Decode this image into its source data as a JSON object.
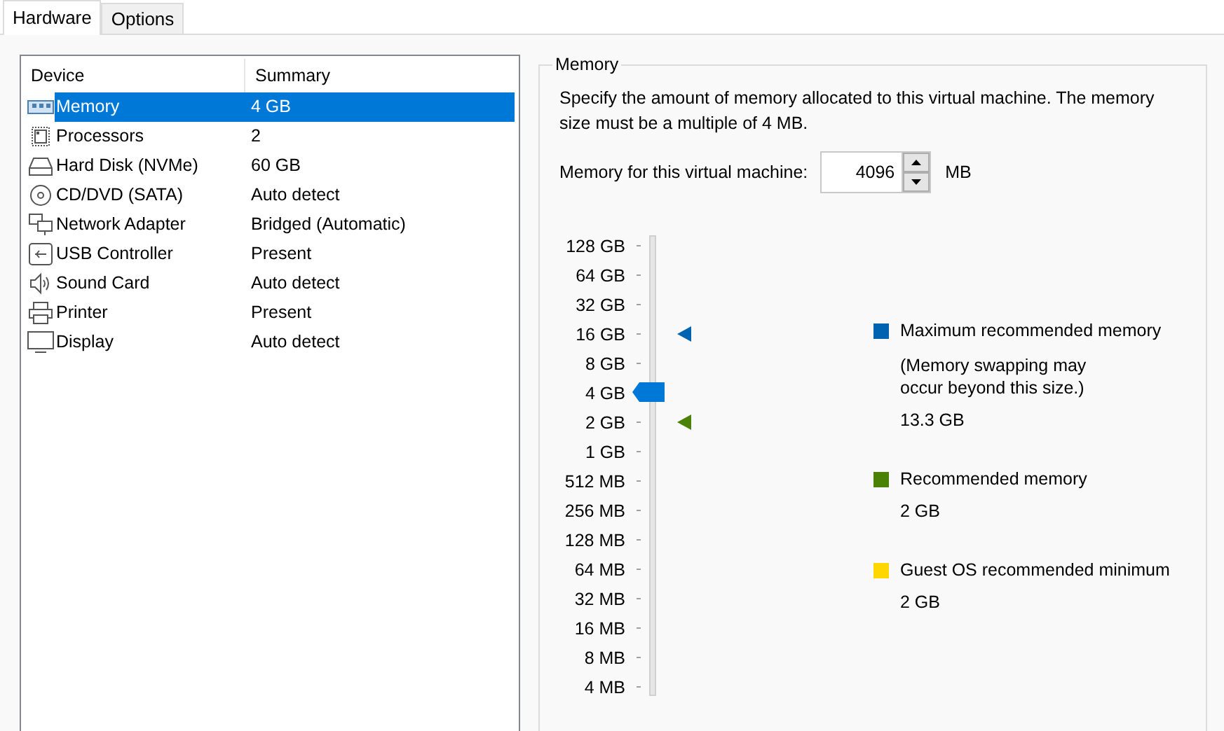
{
  "tabs": [
    {
      "label": "Hardware",
      "selected": true
    },
    {
      "label": "Options",
      "selected": false
    }
  ],
  "device_table": {
    "columns": [
      "Device",
      "Summary"
    ],
    "rows": [
      {
        "kind": "memory",
        "device": "Memory",
        "summary": "4 GB",
        "selected": true
      },
      {
        "kind": "processor",
        "device": "Processors",
        "summary": "2",
        "selected": false
      },
      {
        "kind": "disk",
        "device": "Hard Disk (NVMe)",
        "summary": "60 GB",
        "selected": false
      },
      {
        "kind": "cd",
        "device": "CD/DVD (SATA)",
        "summary": "Auto detect",
        "selected": false
      },
      {
        "kind": "network",
        "device": "Network Adapter",
        "summary": "Bridged (Automatic)",
        "selected": false
      },
      {
        "kind": "usb",
        "device": "USB Controller",
        "summary": "Present",
        "selected": false
      },
      {
        "kind": "sound",
        "device": "Sound Card",
        "summary": "Auto detect",
        "selected": false
      },
      {
        "kind": "printer",
        "device": "Printer",
        "summary": "Present",
        "selected": false
      },
      {
        "kind": "display",
        "device": "Display",
        "summary": "Auto detect",
        "selected": false
      }
    ]
  },
  "memory": {
    "title": "Memory",
    "description": "Specify the amount of memory allocated to this virtual machine. The memory size must be a multiple of 4 MB.",
    "field_label": "Memory for this virtual machine:",
    "value": "4096",
    "unit": "MB",
    "scale": [
      "128 GB",
      "64 GB",
      "32 GB",
      "16 GB",
      "8 GB",
      "4 GB",
      "2 GB",
      "1 GB",
      "512 MB",
      "256 MB",
      "128 MB",
      "64 MB",
      "32 MB",
      "16 MB",
      "8 MB",
      "4 MB"
    ],
    "level": 0.6667,
    "markers": [
      {
        "level": 0.8,
        "color": "#0063b1"
      },
      {
        "level": 0.6,
        "color": "#498205"
      }
    ],
    "legend": [
      {
        "label": "Maximum recommended memory",
        "note": "(Memory swapping may occur beyond this size.)",
        "value": "13.3 GB",
        "color": "#0063b1"
      },
      {
        "label": "Recommended memory",
        "value": "2 GB",
        "color": "#498205"
      },
      {
        "label": "Guest OS recommended minimum",
        "value": "2 GB",
        "color": "#ffd700"
      }
    ]
  }
}
